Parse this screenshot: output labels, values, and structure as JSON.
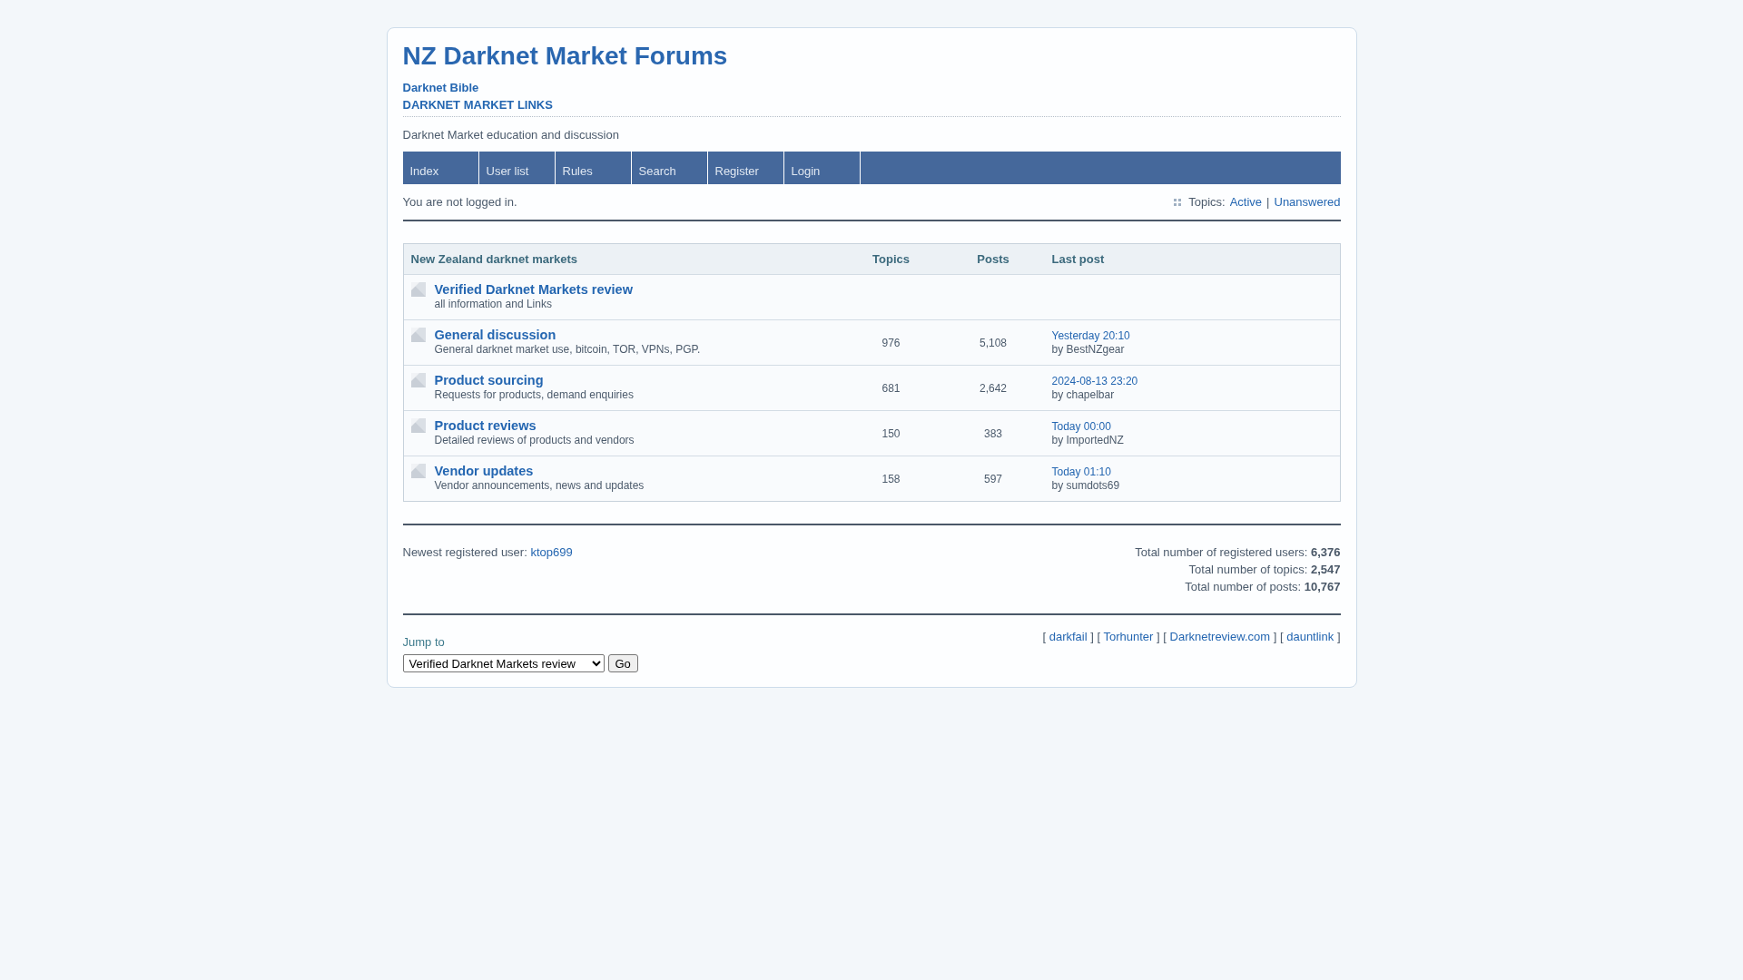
{
  "header": {
    "title": "NZ Darknet Market Forums",
    "links": [
      "Darknet Bible",
      "DARKNET MARKET LINKS"
    ],
    "description": "Darknet Market education and discussion"
  },
  "nav": [
    "Index",
    "User list",
    "Rules",
    "Search",
    "Register",
    "Login"
  ],
  "status": {
    "message": "You are not logged in.",
    "topics_label": "Topics:",
    "topic_links": [
      "Active",
      "Unanswered"
    ],
    "separator": "|"
  },
  "forum_table": {
    "columns": [
      "New Zealand darknet markets",
      "Topics",
      "Posts",
      "Last post"
    ],
    "rows": [
      {
        "name": "Verified Darknet Markets review",
        "description": "all information and Links"
      },
      {
        "name": "General discussion",
        "description": "General darknet market use, bitcoin, TOR, VPNs, PGP.",
        "topics": "976",
        "posts": "5,108",
        "last_post": {
          "time": "Yesterday 20:10",
          "author": "by BestNZgear"
        }
      },
      {
        "name": "Product sourcing",
        "description": "Requests for products, demand enquiries",
        "topics": "681",
        "posts": "2,642",
        "last_post": {
          "time": "2024-08-13 23:20",
          "author": "by chapelbar"
        }
      },
      {
        "name": "Product reviews",
        "description": "Detailed reviews of products and vendors",
        "topics": "150",
        "posts": "383",
        "last_post": {
          "time": "Today 00:00",
          "author": "by ImportedNZ"
        }
      },
      {
        "name": "Vendor updates",
        "description": "Vendor announcements, news and updates",
        "topics": "158",
        "posts": "597",
        "last_post": {
          "time": "Today 01:10",
          "author": "by sumdots69"
        }
      }
    ]
  },
  "stats": {
    "newest_user_label": "Newest registered user:",
    "newest_user": "ktop699",
    "totals": [
      "Total number of registered users: **6,376**",
      "Total number of topics: **2,547**",
      "Total number of posts: **10,767**"
    ]
  },
  "footer": {
    "jump_label": "Jump to",
    "jump_select": "Verified Darknet Markets review",
    "go_button": "Go",
    "bracket_open": "[",
    "bracket_close": "]",
    "links": [
      "darkfail",
      "Torhunter",
      "Darknetreview.com",
      "dauntlink"
    ]
  }
}
